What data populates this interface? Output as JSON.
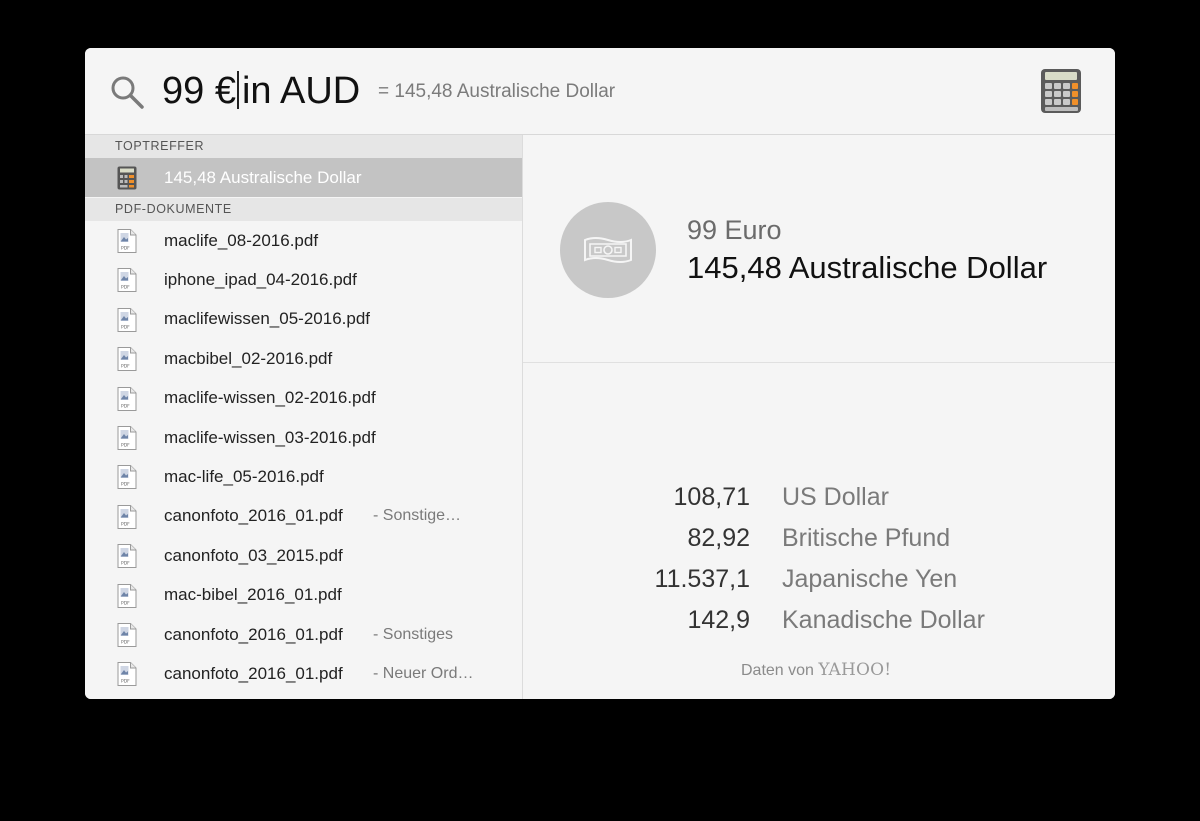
{
  "search": {
    "query_before_caret": "99 €",
    "query_after_caret": "in AUD",
    "suggestion": "= 145,48 Australische Dollar"
  },
  "sections": {
    "top_hits": "TOPTREFFER",
    "pdf_documents": "PDF-DOKUMENTE"
  },
  "top_hit": {
    "label": "145,48 Australische Dollar",
    "icon": "calculator-icon"
  },
  "pdf_items": [
    {
      "name": "maclife_08-2016.pdf",
      "sub": ""
    },
    {
      "name": "iphone_ipad_04-2016.pdf",
      "sub": ""
    },
    {
      "name": "maclifewissen_05-2016.pdf",
      "sub": ""
    },
    {
      "name": "macbibel_02-2016.pdf",
      "sub": ""
    },
    {
      "name": "maclife-wissen_02-2016.pdf",
      "sub": ""
    },
    {
      "name": "maclife-wissen_03-2016.pdf",
      "sub": ""
    },
    {
      "name": "mac-life_05-2016.pdf",
      "sub": ""
    },
    {
      "name": "canonfoto_2016_01.pdf",
      "sub": "- Sonstige…"
    },
    {
      "name": "canonfoto_03_2015.pdf",
      "sub": ""
    },
    {
      "name": "mac-bibel_2016_01.pdf",
      "sub": ""
    },
    {
      "name": "canonfoto_2016_01.pdf",
      "sub": "- Sonstiges"
    },
    {
      "name": "canonfoto_2016_01.pdf",
      "sub": "- Neuer Ord…"
    }
  ],
  "preview": {
    "from_amount": "99 Euro",
    "to_amount": "145,48 Australische Dollar",
    "rates": [
      {
        "value": "108,71",
        "currency": "US Dollar"
      },
      {
        "value": "82,92",
        "currency": "Britische Pfund"
      },
      {
        "value": "11.537,1",
        "currency": "Japanische Yen"
      },
      {
        "value": "142,9",
        "currency": "Kanadische Dollar"
      }
    ],
    "credit_prefix": "Daten von",
    "credit_brand": "YAHOO!"
  },
  "colors": {
    "selection": "#c3c3c3",
    "panel": "#f5f5f5",
    "calculator_orange": "#f0902a"
  }
}
